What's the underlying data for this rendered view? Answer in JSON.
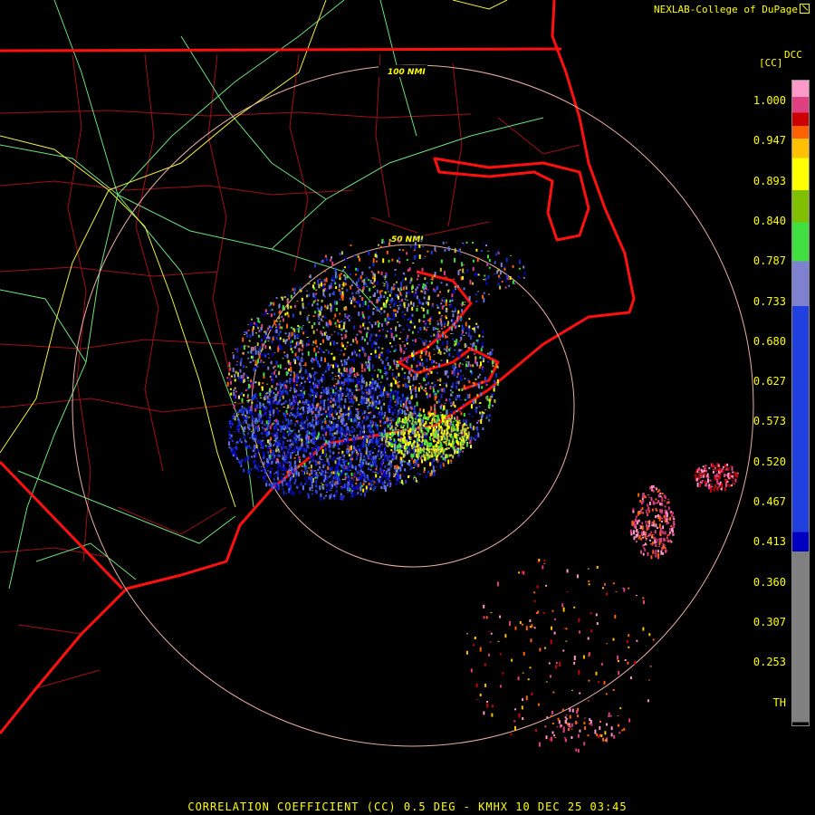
{
  "header": {
    "credit": "NEXLAB-College of DuPage"
  },
  "legend": {
    "product_code": "DCC",
    "units": "[CC]",
    "ticks": [
      "1.000",
      "0.947",
      "0.893",
      "0.840",
      "0.787",
      "0.733",
      "0.680",
      "0.627",
      "0.573",
      "0.520",
      "0.467",
      "0.413",
      "0.360",
      "0.307",
      "0.253",
      "TH"
    ],
    "colors": [
      "#ff9ac8",
      "#e04080",
      "#cc0000",
      "#ff6000",
      "#ffc000",
      "#ffff00",
      "#80c000",
      "#40e040",
      "#8080d0",
      "#2040e0",
      "#0000c0",
      "#808080",
      "#000000"
    ]
  },
  "rings": {
    "inner_label": "50 NMI",
    "outer_label": "100 NMI"
  },
  "footer": {
    "caption": "CORRELATION COEFFICIENT (CC) 0.5 DEG - KMHX 10 DEC 25 03:45"
  }
}
